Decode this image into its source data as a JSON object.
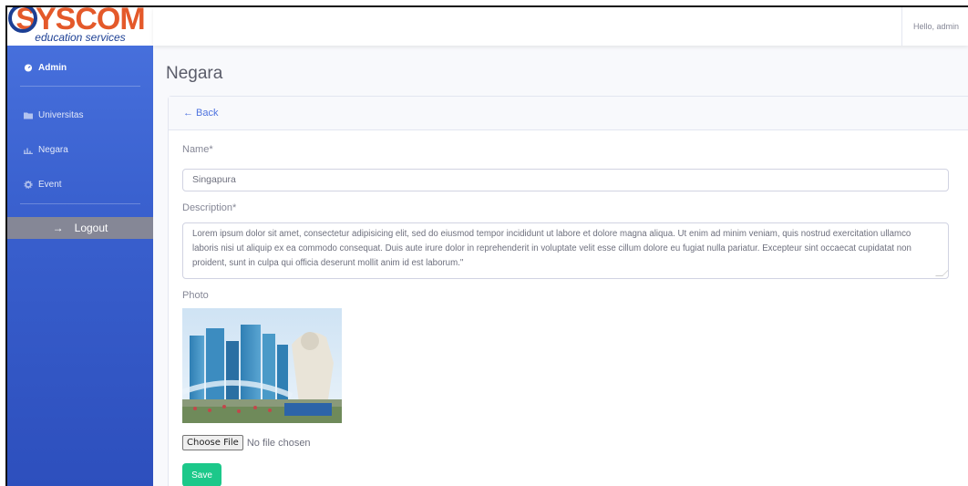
{
  "brand": {
    "logo_main": "SYSCOM",
    "logo_sub": "education services"
  },
  "sidebar": {
    "heading": {
      "label": "Admin",
      "icon": "tachometer-icon"
    },
    "items": [
      {
        "label": "Universitas",
        "icon": "folder-icon"
      },
      {
        "label": "Negara",
        "icon": "chart-icon"
      },
      {
        "label": "Event",
        "icon": "gear-icon"
      }
    ],
    "logout_label": "Logout",
    "logout_icon": "arrow-right-icon"
  },
  "topbar": {
    "greeting": "Hello, admin"
  },
  "page": {
    "title": "Negara"
  },
  "card": {
    "back_label": "← Back",
    "name_label": "Name*",
    "name_value": "Singapura",
    "description_label": "Description*",
    "description_value": "Lorem ipsum dolor sit amet, consectetur adipisicing elit, sed do eiusmod tempor incididunt ut labore et dolore magna aliqua. Ut enim ad minim veniam, quis nostrud exercitation ullamco laboris nisi ut aliquip ex ea commodo consequat. Duis aute irure dolor in reprehenderit in voluptate velit esse cillum dolore eu fugiat nulla pariatur. Excepteur sint occaecat cupidatat non proident, sunt in culpa qui officia deserunt mollit anim id est laborum.\"",
    "photo_label": "Photo",
    "file_button": "Choose File",
    "file_status": "No file chosen",
    "save_label": "Save"
  },
  "colors": {
    "primary": "#4e73df",
    "success": "#1cc88a",
    "sidebar_top": "#4a73df",
    "logout_bg": "#858796"
  }
}
